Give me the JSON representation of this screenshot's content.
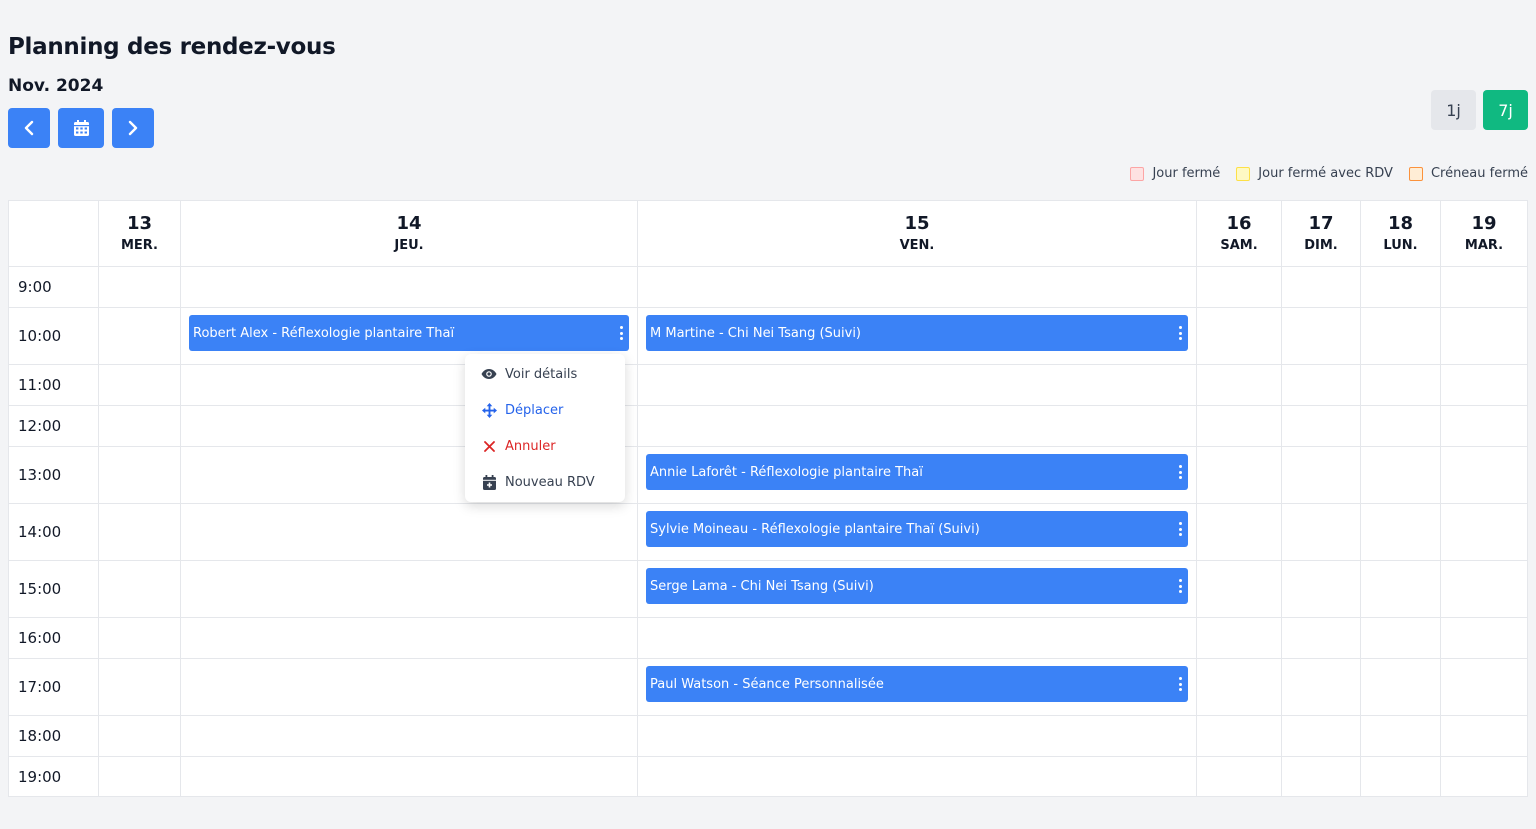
{
  "header": {
    "title": "Planning des rendez-vous",
    "month": "Nov. 2024"
  },
  "view_toggle": {
    "one_day": "1j",
    "seven_days": "7j",
    "active": "7j"
  },
  "legend": [
    {
      "label": "Jour fermé",
      "fill": "#fee2e2",
      "border": "#fca5a5"
    },
    {
      "label": "Jour fermé avec RDV",
      "fill": "#fef9c3",
      "border": "#fde047"
    },
    {
      "label": "Créneau fermé",
      "fill": "#ffedd5",
      "border": "#fb923c"
    }
  ],
  "days": [
    {
      "num": "13",
      "name": "MER."
    },
    {
      "num": "14",
      "name": "JEU."
    },
    {
      "num": "15",
      "name": "VEN."
    },
    {
      "num": "16",
      "name": "SAM."
    },
    {
      "num": "17",
      "name": "DIM."
    },
    {
      "num": "18",
      "name": "LUN."
    },
    {
      "num": "19",
      "name": "MAR."
    }
  ],
  "hours": [
    "9:00",
    "10:00",
    "11:00",
    "12:00",
    "13:00",
    "14:00",
    "15:00",
    "16:00",
    "17:00",
    "18:00",
    "19:00"
  ],
  "events": [
    {
      "label": "Robert Alex - Réflexologie plantaire Thaï",
      "day": "14",
      "hour": "10:00"
    },
    {
      "label": "M Martine - Chi Nei Tsang (Suivi)",
      "day": "15",
      "hour": "10:00"
    },
    {
      "label": "Annie Laforêt - Réflexologie plantaire Thaï",
      "day": "15",
      "hour": "13:00"
    },
    {
      "label": "Sylvie Moineau - Réflexologie plantaire Thaï (Suivi)",
      "day": "15",
      "hour": "14:00"
    },
    {
      "label": "Serge Lama - Chi Nei Tsang (Suivi)",
      "day": "15",
      "hour": "15:00"
    },
    {
      "label": "Paul Watson - Séance Personnalisée",
      "day": "15",
      "hour": "17:00"
    }
  ],
  "context_menu": {
    "items": [
      {
        "label": "Voir détails",
        "icon": "eye-icon",
        "color": "#374151"
      },
      {
        "label": "Déplacer",
        "icon": "move-icon",
        "color": "#2563eb"
      },
      {
        "label": "Annuler",
        "icon": "x-icon",
        "color": "#dc2626"
      },
      {
        "label": "Nouveau RDV",
        "icon": "calendar-plus-icon",
        "color": "#374151"
      }
    ]
  },
  "colors": {
    "primary": "#3b82f6",
    "active_view": "#10b981",
    "background": "#f3f4f6"
  }
}
